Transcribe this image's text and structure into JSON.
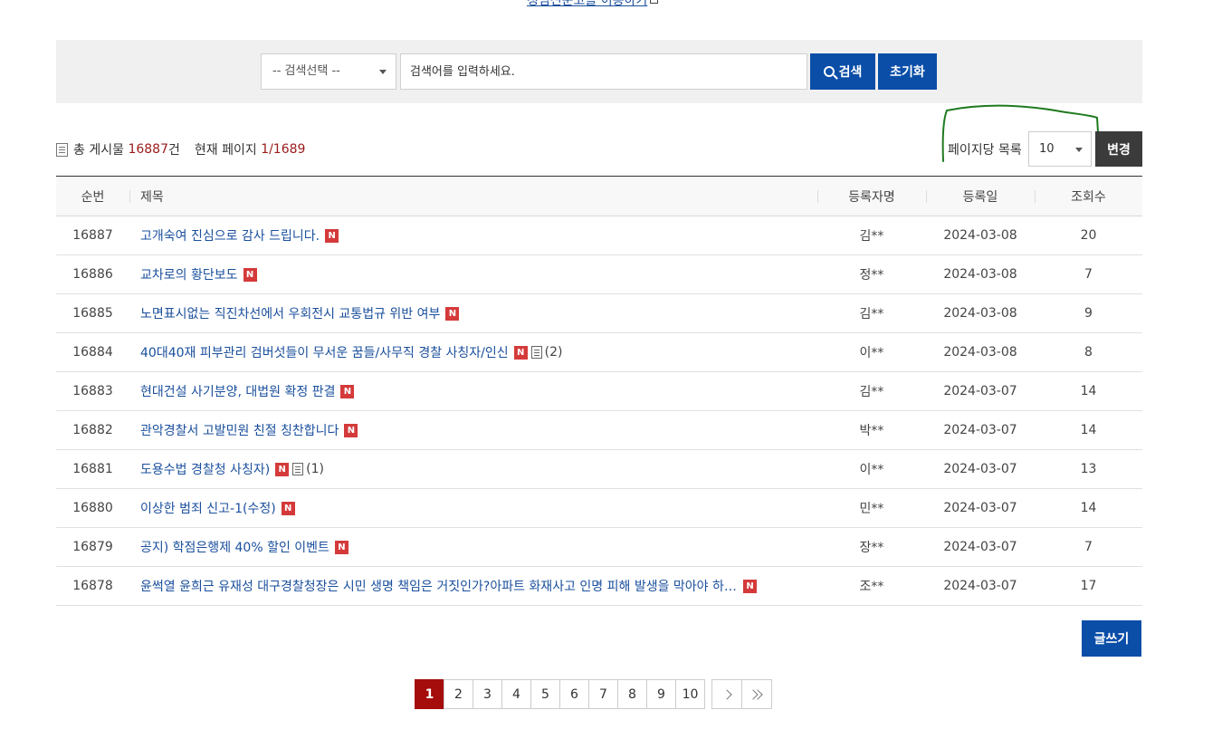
{
  "top_link": {
    "label": "청렴신문고를 이용하기"
  },
  "search": {
    "select_label": "-- 검색선택 --",
    "placeholder": "검색어를 입력하세요.",
    "search_button": "검색",
    "reset_button": "초기화"
  },
  "summary": {
    "total_prefix": "총 게시물",
    "total_count": "16887",
    "total_suffix": "건",
    "page_prefix": "현재 페이지",
    "page_value": "1/1689"
  },
  "per_page": {
    "label": "페이지당 목록",
    "value": "10",
    "change_button": "변경"
  },
  "table": {
    "headers": [
      "순번",
      "제목",
      "등록자명",
      "등록일",
      "조회수"
    ],
    "rows": [
      {
        "no": "16887",
        "title": "고개숙여 진심으로 감사 드립니다.",
        "new": "N",
        "file": false,
        "comments": "",
        "author": "김**",
        "date": "2024-03-08",
        "views": "20"
      },
      {
        "no": "16886",
        "title": "교차로의 황단보도",
        "new": "N",
        "file": false,
        "comments": "",
        "author": "정**",
        "date": "2024-03-08",
        "views": "7"
      },
      {
        "no": "16885",
        "title": "노면표시없는 직진차선에서 우회전시 교통법규 위반 여부",
        "new": "N",
        "file": false,
        "comments": "",
        "author": "김**",
        "date": "2024-03-08",
        "views": "9"
      },
      {
        "no": "16884",
        "title": "40대40재 피부관리 검버섯들이 무서운 꿈들/사무직 경찰 사칭자/인신",
        "new": "N",
        "file": true,
        "comments": "(2)",
        "author": "이**",
        "date": "2024-03-08",
        "views": "8"
      },
      {
        "no": "16883",
        "title": "현대건설 사기분양, 대법원 확정 판결",
        "new": "N",
        "file": false,
        "comments": "",
        "author": "김**",
        "date": "2024-03-07",
        "views": "14"
      },
      {
        "no": "16882",
        "title": "관악경찰서 고발민원 친절 칭찬합니다",
        "new": "N",
        "file": false,
        "comments": "",
        "author": "박**",
        "date": "2024-03-07",
        "views": "14"
      },
      {
        "no": "16881",
        "title": "도용수법 경찰청 사칭자)",
        "new": "N",
        "file": true,
        "comments": "(1)",
        "author": "이**",
        "date": "2024-03-07",
        "views": "13"
      },
      {
        "no": "16880",
        "title": "이상한 범죄 신고-1(수정)",
        "new": "N",
        "file": false,
        "comments": "",
        "author": "민**",
        "date": "2024-03-07",
        "views": "14"
      },
      {
        "no": "16879",
        "title": "공지) 학점은행제 40% 할인 이벤트",
        "new": "N",
        "file": false,
        "comments": "",
        "author": "장**",
        "date": "2024-03-07",
        "views": "7"
      },
      {
        "no": "16878",
        "title": "윤썩열 윤희근 유재성 대구경찰청장은 시민 생명 책임은 거짓인가?아파트 화재사고 인명 피해 발생을 막아야 하는 게…",
        "new": "N",
        "file": false,
        "comments": "",
        "author": "조**",
        "date": "2024-03-07",
        "views": "17"
      }
    ]
  },
  "write_button": "글쓰기",
  "pagination": {
    "pages": [
      "1",
      "2",
      "3",
      "4",
      "5",
      "6",
      "7",
      "8",
      "9",
      "10"
    ],
    "active": "1"
  },
  "colors": {
    "primary_blue": "#0a4ea8",
    "active_page": "#a50c0c",
    "new_badge": "#d43a3a",
    "annotation_stroke": "#1f7a1f"
  }
}
